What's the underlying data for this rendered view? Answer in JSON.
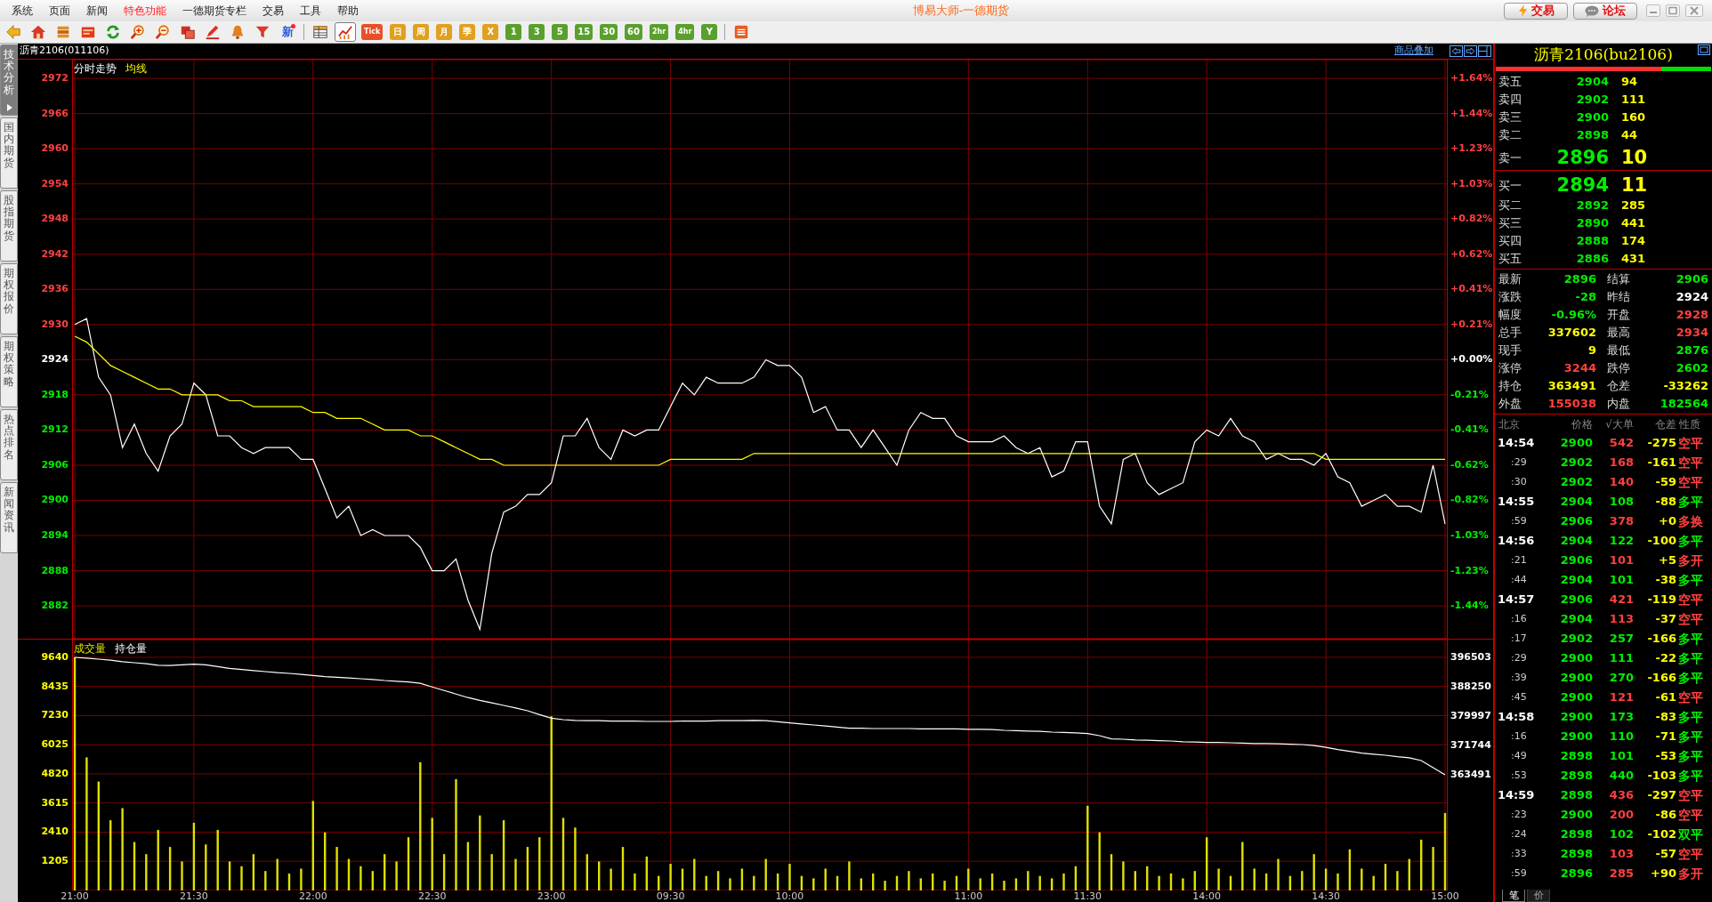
{
  "menu": [
    {
      "label": "系统",
      "highlighted": false
    },
    {
      "label": "页面",
      "highlighted": false
    },
    {
      "label": "新闻",
      "highlighted": false
    },
    {
      "label": "特色功能",
      "highlighted": true
    },
    {
      "label": "一德期货专栏",
      "highlighted": false
    },
    {
      "label": "交易",
      "highlighted": false
    },
    {
      "label": "工具",
      "highlighted": false
    },
    {
      "label": "帮助",
      "highlighted": false
    }
  ],
  "app_title": "博易大师-一德期货",
  "top_buttons": [
    {
      "kind": "trade",
      "label": "交易"
    },
    {
      "kind": "forum",
      "label": "论坛"
    }
  ],
  "toolbar": [
    {
      "kind": "back",
      "selected": false
    },
    {
      "kind": "home",
      "selected": false
    },
    {
      "kind": "books",
      "selected": false
    },
    {
      "kind": "document",
      "selected": false
    },
    {
      "kind": "refresh",
      "selected": false
    },
    {
      "kind": "zoomin",
      "selected": false
    },
    {
      "kind": "zoomout",
      "selected": false
    },
    {
      "kind": "windows",
      "selected": false
    },
    {
      "kind": "pen",
      "selected": false
    },
    {
      "kind": "bell",
      "selected": false
    },
    {
      "kind": "filter",
      "selected": false
    },
    {
      "kind": "label",
      "label": "新",
      "selected": false
    },
    {
      "kind": "separator"
    },
    {
      "kind": "table",
      "selected": false
    },
    {
      "kind": "chart",
      "selected": true
    },
    {
      "kind": "tile",
      "label": "Tick",
      "color": "#e8502a",
      "selected": false
    },
    {
      "kind": "tile",
      "label": "日",
      "color": "#e0a020",
      "selected": false
    },
    {
      "kind": "tile",
      "label": "周",
      "color": "#e0a020",
      "selected": false
    },
    {
      "kind": "tile",
      "label": "月",
      "color": "#e0a020",
      "selected": false
    },
    {
      "kind": "tile",
      "label": "季",
      "color": "#e0a020",
      "selected": false
    },
    {
      "kind": "tile",
      "label": "X",
      "color": "#e0a020",
      "selected": false
    },
    {
      "kind": "tile",
      "label": "1",
      "color": "#5aa02c",
      "selected": false
    },
    {
      "kind": "tile",
      "label": "3",
      "color": "#5aa02c",
      "selected": false
    },
    {
      "kind": "tile",
      "label": "5",
      "color": "#5aa02c",
      "selected": false
    },
    {
      "kind": "tile",
      "label": "15",
      "color": "#5aa02c",
      "selected": false
    },
    {
      "kind": "tile",
      "label": "30",
      "color": "#5aa02c",
      "selected": false
    },
    {
      "kind": "tile",
      "label": "60",
      "color": "#5aa02c",
      "selected": false
    },
    {
      "kind": "tile",
      "label": "2hr",
      "color": "#5aa02c",
      "selected": false
    },
    {
      "kind": "tile",
      "label": "4hr",
      "color": "#5aa02c",
      "selected": false
    },
    {
      "kind": "tile",
      "label": "Y",
      "color": "#5aa02c",
      "selected": false
    },
    {
      "kind": "separator"
    },
    {
      "kind": "list",
      "selected": false
    }
  ],
  "sidebar_tabs": [
    {
      "label": "技术分析",
      "selected": true
    },
    {
      "label": "国内期货",
      "selected": false
    },
    {
      "label": "股指期货",
      "selected": false
    },
    {
      "label": "期权报价",
      "selected": false
    },
    {
      "label": "期权策略",
      "selected": false
    },
    {
      "label": "热点排名",
      "selected": false
    },
    {
      "label": "新闻资讯",
      "selected": false
    }
  ],
  "chart_header": {
    "title": "沥青2106(011106)",
    "overlay_link": "商品叠加"
  },
  "price_panel": {
    "percent_axis": [
      {
        "label": "+1.64%",
        "color": "#ff4040"
      },
      {
        "label": "+1.44%",
        "color": "#ff4040"
      },
      {
        "label": "+1.23%",
        "color": "#ff4040"
      },
      {
        "label": "+1.03%",
        "color": "#ff4040"
      },
      {
        "label": "+0.82%",
        "color": "#ff4040"
      },
      {
        "label": "+0.62%",
        "color": "#ff4040"
      },
      {
        "label": "+0.41%",
        "color": "#ff4040"
      },
      {
        "label": "+0.21%",
        "color": "#ff4040"
      },
      {
        "label": "+0.00%",
        "color": "#ffffff"
      },
      {
        "label": "-0.21%",
        "color": "#00ee00"
      },
      {
        "label": "-0.41%",
        "color": "#00ee00"
      },
      {
        "label": "-0.62%",
        "color": "#00ee00"
      },
      {
        "label": "-0.82%",
        "color": "#00ee00"
      },
      {
        "label": "-1.03%",
        "color": "#00ee00"
      },
      {
        "label": "-1.23%",
        "color": "#00ee00"
      },
      {
        "label": "-1.44%",
        "color": "#00ee00"
      }
    ],
    "chart_data": {
      "type": "line",
      "grid": true,
      "ylim": [
        2876.4,
        2975.2
      ],
      "yticks": [
        2972,
        2966,
        2960,
        2954,
        2948,
        2942,
        2936,
        2930,
        2924,
        2918,
        2912,
        2906,
        2900,
        2894,
        2888,
        2882
      ],
      "series": [
        {
          "name": "分时走势",
          "color": "#ffffff",
          "values": [
            2930,
            2931,
            2921,
            2918,
            2909,
            2913,
            2908,
            2905,
            2911,
            2913,
            2920,
            2918,
            2911,
            2911,
            2909,
            2908,
            2909,
            2909,
            2909,
            2907,
            2907,
            2902,
            2897,
            2899,
            2894,
            2895,
            2894,
            2894,
            2894,
            2892,
            2888,
            2888,
            2890,
            2883,
            2878,
            2891,
            2898,
            2899,
            2901,
            2901,
            2903,
            2911,
            2911,
            2914,
            2909,
            2907,
            2912,
            2911,
            2912,
            2912,
            2916,
            2920,
            2918,
            2921,
            2920,
            2920,
            2920,
            2921,
            2924,
            2923,
            2923,
            2921,
            2915,
            2916,
            2912,
            2912,
            2909,
            2912,
            2909,
            2906,
            2912,
            2915,
            2914,
            2914,
            2911,
            2910,
            2910,
            2910,
            2911,
            2909,
            2908,
            2909,
            2904,
            2905,
            2910,
            2910,
            2899,
            2896,
            2907,
            2908,
            2903,
            2901,
            2902,
            2903,
            2910,
            2912,
            2911,
            2914,
            2911,
            2910,
            2907,
            2908,
            2907,
            2907,
            2906,
            2908,
            2904,
            2903,
            2899,
            2900,
            2901,
            2899,
            2899,
            2898,
            2906,
            2896
          ]
        },
        {
          "name": "均线",
          "color": "#ffff00",
          "values": [
            2928,
            2927,
            2925,
            2923,
            2922,
            2921,
            2920,
            2919,
            2919,
            2918,
            2918,
            2918,
            2918,
            2917,
            2917,
            2916,
            2916,
            2916,
            2916,
            2916,
            2915,
            2915,
            2914,
            2914,
            2914,
            2913,
            2912,
            2912,
            2912,
            2911,
            2911,
            2910,
            2909,
            2908,
            2907,
            2907,
            2906,
            2906,
            2906,
            2906,
            2906,
            2906,
            2906,
            2906,
            2906,
            2906,
            2906,
            2906,
            2906,
            2906,
            2907,
            2907,
            2907,
            2907,
            2907,
            2907,
            2907,
            2908,
            2908,
            2908,
            2908,
            2908,
            2908,
            2908,
            2908,
            2908,
            2908,
            2908,
            2908,
            2908,
            2908,
            2908,
            2908,
            2908,
            2908,
            2908,
            2908,
            2908,
            2908,
            2908,
            2908,
            2908,
            2908,
            2908,
            2908,
            2908,
            2908,
            2908,
            2908,
            2908,
            2908,
            2908,
            2908,
            2908,
            2908,
            2908,
            2908,
            2908,
            2908,
            2908,
            2908,
            2908,
            2908,
            2908,
            2908,
            2907,
            2907,
            2907,
            2907,
            2907,
            2907,
            2907,
            2907,
            2907,
            2907,
            2907
          ]
        }
      ]
    }
  },
  "volume_panel": {
    "volume": {
      "chart_data": {
        "type": "bar",
        "grid": true,
        "ylim": [
          0,
          10370
        ],
        "yticks": [
          {
            "value": 9640,
            "label": "9640"
          },
          {
            "value": 8435,
            "label": "8435"
          },
          {
            "value": 7230,
            "label": "7230"
          },
          {
            "value": 6025,
            "label": "6025"
          },
          {
            "value": 4820,
            "label": "4820"
          },
          {
            "value": 3615,
            "label": "3615"
          },
          {
            "value": 2410,
            "label": "2410"
          },
          {
            "value": 1205,
            "label": "1205"
          }
        ],
        "categories": [
          "21:00",
          null,
          null,
          null,
          null,
          null,
          null,
          null,
          null,
          null,
          "21:30",
          null,
          null,
          null,
          null,
          null,
          null,
          null,
          null,
          null,
          "22:00",
          null,
          null,
          null,
          null,
          null,
          null,
          null,
          null,
          null,
          "22:30",
          null,
          null,
          null,
          null,
          null,
          null,
          null,
          null,
          null,
          "23:00",
          null,
          null,
          null,
          null,
          null,
          null,
          null,
          null,
          null,
          "09:30",
          null,
          null,
          null,
          null,
          null,
          null,
          null,
          null,
          null,
          "10:00",
          null,
          null,
          null,
          null,
          null,
          null,
          null,
          null,
          null,
          null,
          null,
          null,
          null,
          null,
          "11:00",
          null,
          null,
          null,
          null,
          null,
          null,
          null,
          null,
          null,
          "11:30",
          null,
          null,
          null,
          null,
          null,
          null,
          null,
          null,
          null,
          "14:00",
          null,
          null,
          null,
          null,
          null,
          null,
          null,
          null,
          null,
          "14:30",
          null,
          null,
          null,
          null,
          null,
          null,
          null,
          null,
          null,
          "15:00"
        ],
        "series": [
          {
            "name": "成交量",
            "color": "#e0e000",
            "values": [
              9640,
              5500,
              4500,
              2900,
              3400,
              2000,
              1500,
              2500,
              1800,
              1200,
              2800,
              1900,
              2500,
              1200,
              1000,
              1500,
              800,
              1300,
              700,
              900,
              3700,
              2400,
              1800,
              1300,
              1000,
              800,
              1500,
              1200,
              2200,
              5300,
              3000,
              1500,
              4600,
              2000,
              3100,
              1500,
              2900,
              1300,
              1800,
              2200,
              7200,
              3000,
              2600,
              1500,
              1200,
              900,
              1800,
              700,
              1400,
              600,
              1100,
              900,
              1300,
              600,
              800,
              500,
              900,
              600,
              1300,
              700,
              1100,
              600,
              500,
              900,
              600,
              1200,
              500,
              700,
              400,
              600,
              800,
              500,
              700,
              400,
              600,
              900,
              500,
              700,
              400,
              500,
              800,
              600,
              500,
              700,
              1000,
              3500,
              2400,
              1500,
              1200,
              800,
              1000,
              600,
              700,
              500,
              800,
              2200,
              900,
              600,
              2000,
              900,
              700,
              1300,
              600,
              800,
              1500,
              900,
              700,
              1700,
              900,
              600,
              1100,
              800,
              1300,
              2100,
              1800,
              3200
            ]
          }
        ]
      }
    },
    "open_interest": {
      "chart_data": {
        "type": "line",
        "ylim": [
          330980,
          401505
        ],
        "yticks": [
          {
            "value": 396503,
            "label": "396503"
          },
          {
            "value": 388250,
            "label": "388250"
          },
          {
            "value": 379997,
            "label": "379997"
          },
          {
            "value": 371744,
            "label": "371744"
          },
          {
            "value": 363491,
            "label": "363491"
          }
        ],
        "series": [
          {
            "name": "持仓量",
            "color": "#ffffff",
            "values": [
              396500,
              396300,
              396000,
              395700,
              395300,
              395000,
              394700,
              394300,
              394200,
              394400,
              394600,
              394400,
              393900,
              393400,
              393100,
              392800,
              392500,
              392200,
              392000,
              391700,
              391400,
              391100,
              390900,
              390700,
              390500,
              390300,
              390000,
              389800,
              389600,
              389200,
              388200,
              387200,
              386200,
              385200,
              384400,
              383700,
              383000,
              382300,
              381500,
              380400,
              379400,
              379000,
              378800,
              378700,
              378700,
              378600,
              378600,
              378600,
              378500,
              378500,
              378500,
              378600,
              378600,
              378600,
              378700,
              378700,
              378700,
              378800,
              378700,
              378400,
              378100,
              377800,
              377500,
              377200,
              376900,
              376600,
              376600,
              376500,
              376500,
              376500,
              376500,
              376400,
              376400,
              376400,
              376400,
              376300,
              376300,
              376200,
              376000,
              375900,
              375800,
              375700,
              375500,
              375400,
              375300,
              375100,
              374500,
              373600,
              373500,
              373300,
              373200,
              373100,
              373000,
              372800,
              372700,
              372600,
              372600,
              372500,
              372400,
              372300,
              372300,
              372200,
              372100,
              372000,
              371700,
              371200,
              370600,
              370100,
              369600,
              369300,
              369000,
              368600,
              368300,
              367500,
              365500,
              363500
            ]
          }
        ]
      }
    }
  },
  "quote": {
    "title": "沥青2106(bu2106)",
    "level": 0.77,
    "asks": [
      {
        "label": "卖五",
        "price": "2904",
        "volume": "94"
      },
      {
        "label": "卖四",
        "price": "2902",
        "volume": "111"
      },
      {
        "label": "卖三",
        "price": "2900",
        "volume": "160"
      },
      {
        "label": "卖二",
        "price": "2898",
        "volume": "44"
      },
      {
        "label": "卖一",
        "price": "2896",
        "volume": "10"
      }
    ],
    "bids": [
      {
        "label": "买一",
        "price": "2894",
        "volume": "11"
      },
      {
        "label": "买二",
        "price": "2892",
        "volume": "285"
      },
      {
        "label": "买三",
        "price": "2890",
        "volume": "441"
      },
      {
        "label": "买四",
        "price": "2888",
        "volume": "174"
      },
      {
        "label": "买五",
        "price": "2886",
        "volume": "431"
      }
    ],
    "stats": [
      {
        "label": "最新",
        "value": "2896",
        "color": "#00ee00"
      },
      {
        "label": "结算",
        "value": "2906",
        "color": "#00ee00"
      },
      {
        "label": "涨跌",
        "value": "-28",
        "color": "#00ee00"
      },
      {
        "label": "昨结",
        "value": "2924",
        "color": "#ffffff"
      },
      {
        "label": "幅度",
        "value": "-0.96%",
        "color": "#00ee00"
      },
      {
        "label": "开盘",
        "value": "2928",
        "color": "#ff4040"
      },
      {
        "label": "总手",
        "value": "337602",
        "color": "#ffff00"
      },
      {
        "label": "最高",
        "value": "2934",
        "color": "#ff4040"
      },
      {
        "label": "现手",
        "value": "9",
        "color": "#ffff00"
      },
      {
        "label": "最低",
        "value": "2876",
        "color": "#00ee00"
      },
      {
        "label": "涨停",
        "value": "3244",
        "color": "#ff4040"
      },
      {
        "label": "跌停",
        "value": "2602",
        "color": "#00ee00"
      },
      {
        "label": "持仓",
        "value": "363491",
        "color": "#ffff00"
      },
      {
        "label": "仓差",
        "value": "-33262",
        "color": "#ffff00"
      },
      {
        "label": "外盘",
        "value": "155038",
        "color": "#ff4040"
      },
      {
        "label": "内盘",
        "value": "182564",
        "color": "#00ee00"
      }
    ],
    "trade_columns": [
      "北京",
      "价格",
      "√大单",
      "仓差",
      "性质"
    ],
    "trades": [
      {
        "time": "14:54",
        "kind": "minute",
        "price": "2900",
        "volume": {
          "text": "542",
          "color": "#ff4040"
        },
        "change": "-275",
        "nature": {
          "text": "空平",
          "color": "#ff4040"
        }
      },
      {
        "time": ":29",
        "kind": "second",
        "price": "2902",
        "volume": {
          "text": "168",
          "color": "#ff4040"
        },
        "change": "-161",
        "nature": {
          "text": "空平",
          "color": "#ff4040"
        }
      },
      {
        "time": ":30",
        "kind": "second",
        "price": "2902",
        "volume": {
          "text": "140",
          "color": "#ff4040"
        },
        "change": "-59",
        "nature": {
          "text": "空平",
          "color": "#ff4040"
        }
      },
      {
        "time": "14:55",
        "kind": "minute",
        "price": "2904",
        "volume": {
          "text": "108",
          "color": "#00ee00"
        },
        "change": "-88",
        "nature": {
          "text": "多平",
          "color": "#00ee00"
        }
      },
      {
        "time": ":59",
        "kind": "second",
        "price": "2906",
        "volume": {
          "text": "378",
          "color": "#ff4040"
        },
        "change": "+0",
        "nature": {
          "text": "多换",
          "color": "#ff4040"
        }
      },
      {
        "time": "14:56",
        "kind": "minute",
        "price": "2904",
        "volume": {
          "text": "122",
          "color": "#00ee00"
        },
        "change": "-100",
        "nature": {
          "text": "多平",
          "color": "#00ee00"
        }
      },
      {
        "time": ":21",
        "kind": "second",
        "price": "2906",
        "volume": {
          "text": "101",
          "color": "#ff4040"
        },
        "change": "+5",
        "nature": {
          "text": "多开",
          "color": "#ff4040"
        }
      },
      {
        "time": ":44",
        "kind": "second",
        "price": "2904",
        "volume": {
          "text": "101",
          "color": "#00ee00"
        },
        "change": "-38",
        "nature": {
          "text": "多平",
          "color": "#00ee00"
        }
      },
      {
        "time": "14:57",
        "kind": "minute",
        "price": "2906",
        "volume": {
          "text": "421",
          "color": "#ff4040"
        },
        "change": "-119",
        "nature": {
          "text": "空平",
          "color": "#ff4040"
        }
      },
      {
        "time": ":16",
        "kind": "second",
        "price": "2904",
        "volume": {
          "text": "113",
          "color": "#ff4040"
        },
        "change": "-37",
        "nature": {
          "text": "空平",
          "color": "#ff4040"
        }
      },
      {
        "time": ":17",
        "kind": "second",
        "price": "2902",
        "volume": {
          "text": "257",
          "color": "#00ee00"
        },
        "change": "-166",
        "nature": {
          "text": "多平",
          "color": "#00ee00"
        }
      },
      {
        "time": ":29",
        "kind": "second",
        "price": "2900",
        "volume": {
          "text": "111",
          "color": "#00ee00"
        },
        "change": "-22",
        "nature": {
          "text": "多平",
          "color": "#00ee00"
        }
      },
      {
        "time": ":39",
        "kind": "second",
        "price": "2900",
        "volume": {
          "text": "270",
          "color": "#00ee00"
        },
        "change": "-166",
        "nature": {
          "text": "多平",
          "color": "#00ee00"
        }
      },
      {
        "time": ":45",
        "kind": "second",
        "price": "2900",
        "volume": {
          "text": "121",
          "color": "#ff4040"
        },
        "change": "-61",
        "nature": {
          "text": "空平",
          "color": "#ff4040"
        }
      },
      {
        "time": "14:58",
        "kind": "minute",
        "price": "2900",
        "volume": {
          "text": "173",
          "color": "#00ee00"
        },
        "change": "-83",
        "nature": {
          "text": "多平",
          "color": "#00ee00"
        }
      },
      {
        "time": ":16",
        "kind": "second",
        "price": "2900",
        "volume": {
          "text": "110",
          "color": "#00ee00"
        },
        "change": "-71",
        "nature": {
          "text": "多平",
          "color": "#00ee00"
        }
      },
      {
        "time": ":49",
        "kind": "second",
        "price": "2898",
        "volume": {
          "text": "101",
          "color": "#00ee00"
        },
        "change": "-53",
        "nature": {
          "text": "多平",
          "color": "#00ee00"
        }
      },
      {
        "time": ":53",
        "kind": "second",
        "price": "2898",
        "volume": {
          "text": "440",
          "color": "#00ee00"
        },
        "change": "-103",
        "nature": {
          "text": "多平",
          "color": "#00ee00"
        }
      },
      {
        "time": "14:59",
        "kind": "minute",
        "price": "2898",
        "volume": {
          "text": "436",
          "color": "#ff4040"
        },
        "change": "-297",
        "nature": {
          "text": "空平",
          "color": "#ff4040"
        }
      },
      {
        "time": ":23",
        "kind": "second",
        "price": "2900",
        "volume": {
          "text": "200",
          "color": "#ff4040"
        },
        "change": "-86",
        "nature": {
          "text": "空平",
          "color": "#ff4040"
        }
      },
      {
        "time": ":24",
        "kind": "second",
        "price": "2898",
        "volume": {
          "text": "102",
          "color": "#00ee00"
        },
        "change": "-102",
        "nature": {
          "text": "双平",
          "color": "#00ee00"
        }
      },
      {
        "time": ":33",
        "kind": "second",
        "price": "2898",
        "volume": {
          "text": "103",
          "color": "#ff4040"
        },
        "change": "-57",
        "nature": {
          "text": "空平",
          "color": "#ff4040"
        }
      },
      {
        "time": ":59",
        "kind": "second",
        "price": "2896",
        "volume": {
          "text": "285",
          "color": "#ff4040"
        },
        "change": "+90",
        "nature": {
          "text": "多开",
          "color": "#ff4040"
        }
      }
    ],
    "bottom_tabs": [
      {
        "label": "笔",
        "selected": true
      },
      {
        "label": "价",
        "selected": false
      }
    ]
  }
}
